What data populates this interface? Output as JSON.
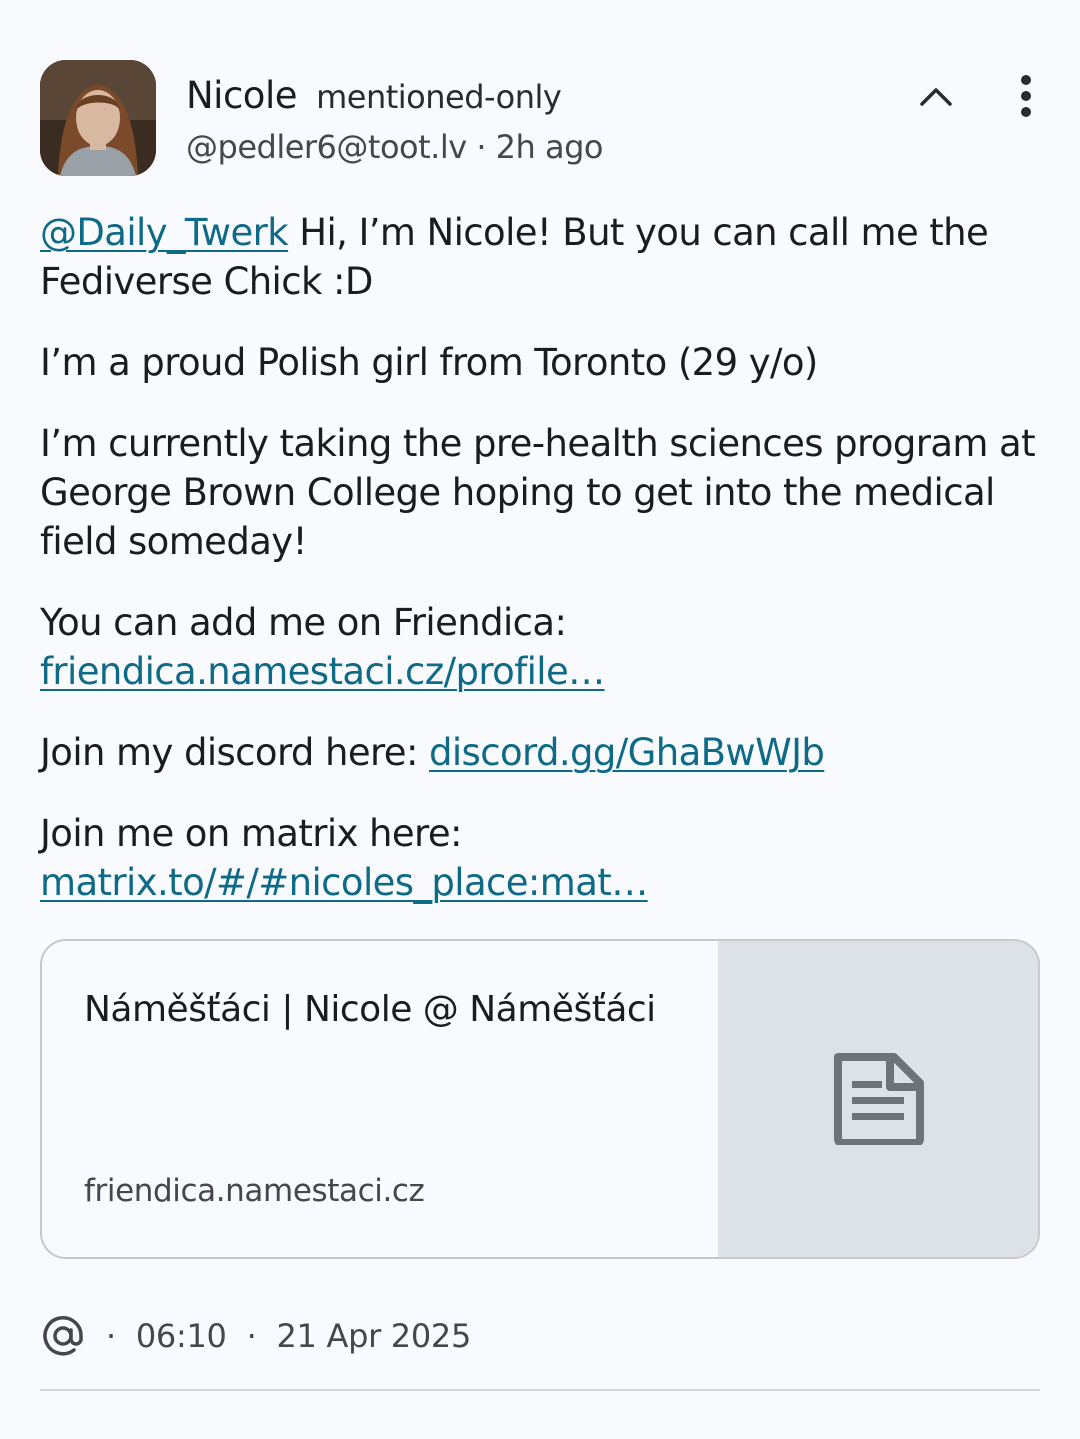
{
  "author": {
    "display_name": "Nicole",
    "visibility": "mentioned-only",
    "handle": "@pedler6@toot.lv",
    "relative_time": "2h ago",
    "separator": "·"
  },
  "icons": {
    "collapse": "chevron-up-icon",
    "more": "more-vert-icon",
    "card_thumbnail": "document-icon",
    "visibility_direct": "at-sign-icon"
  },
  "content": {
    "p1_mention": "@Daily_Twerk",
    "p1_text": " Hi, I’m Nicole! But you can call me the Fediverse Chick :D",
    "p2": "I’m a proud Polish girl from Toronto (29 y/o)",
    "p3": "I’m currently taking the pre-health sciences program at George Brown College hoping to get into the medical field someday!",
    "p4_text": "You can add me on Friendica: ",
    "p4_link": "friendica.namestaci.cz/profile…",
    "p5_text": "Join my discord here: ",
    "p5_link": "discord.gg/GhaBwWJb",
    "p6_text": "Join me on matrix here: ",
    "p6_link": "matrix.to/#/#nicoles_place:mat…"
  },
  "card": {
    "title": "Náměšťáci | Nicole @ Náměšťáci",
    "domain": "friendica.namestaci.cz"
  },
  "meta": {
    "at_symbol": "@",
    "separator": "·",
    "time": "06:10",
    "date": "21 Apr 2025"
  },
  "colors": {
    "background": "#f8fafd",
    "link": "#0e6a86",
    "text": "#1b1c1f",
    "secondary_text": "#44474e",
    "card_border": "#c6c8cc",
    "card_thumb_bg": "#dde2e8",
    "icon": "#2a2b2e"
  }
}
